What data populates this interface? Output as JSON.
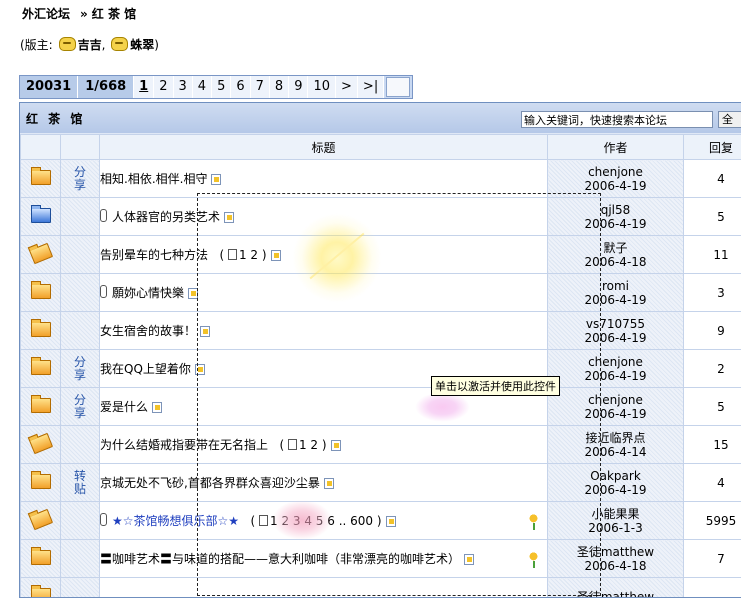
{
  "breadcrumb": {
    "forum": "外汇论坛",
    "separator": "»",
    "board": "红 茶 馆"
  },
  "moderators": {
    "prefix": "(版主:",
    "names": [
      "吉吉",
      "蛛翠"
    ],
    "suffix": ")"
  },
  "pager": {
    "total_threads": "20031",
    "current": "1/668",
    "pages": [
      "1",
      "2",
      "3",
      "4",
      "5",
      "6",
      "7",
      "8",
      "9",
      "10"
    ],
    "next": ">",
    "last": ">|"
  },
  "board_header": {
    "title": "红 茶 馆",
    "search_placeholder": "输入关键词，快速搜索本论坛",
    "search_button": "全"
  },
  "columns": {
    "title": "标题",
    "author": "作者",
    "replies": "回复"
  },
  "new_badge": "NEW",
  "threads": [
    {
      "icon": "folder",
      "tag": "分享",
      "title": "相知.相依.相伴.相守",
      "author": "chenjone",
      "date": "2006-4-19",
      "replies": "4"
    },
    {
      "icon": "folder-blue",
      "tag": "",
      "clip": true,
      "title": "人体器官的另类艺术",
      "author": "qjl58",
      "date": "2006-4-19",
      "replies": "5"
    },
    {
      "icon": "folder-open",
      "tag": "",
      "title": "告别晕车的七种方法",
      "pages": "1 2",
      "author": "默子",
      "date": "2006-4-18",
      "replies": "11"
    },
    {
      "icon": "folder",
      "tag": "",
      "clip": true,
      "title": "願妳心情快樂",
      "author": "romi",
      "date": "2006-4-19",
      "replies": "3"
    },
    {
      "icon": "folder",
      "tag": "",
      "title": "女生宿舍的故事！",
      "author": "vs710755",
      "date": "2006-4-19",
      "replies": "9"
    },
    {
      "icon": "folder",
      "tag": "分享",
      "title": "我在QQ上望着你",
      "author": "chenjone",
      "date": "2006-4-19",
      "replies": "2"
    },
    {
      "icon": "folder",
      "tag": "分享",
      "title": "爱是什么",
      "author": "chenjone",
      "date": "2006-4-19",
      "replies": "5"
    },
    {
      "icon": "folder-open",
      "tag": "",
      "title": "为什么结婚戒指要带在无名指上",
      "pages": "1 2",
      "author": "接近临界点",
      "date": "2006-4-14",
      "replies": "15"
    },
    {
      "icon": "folder",
      "tag": "转贴",
      "title": "京城无处不飞砂,首都各界群众喜迎沙尘暴",
      "author": "Oakpark",
      "date": "2006-4-19",
      "replies": "4"
    },
    {
      "icon": "folder-open",
      "tag": "",
      "clip": true,
      "title": "★☆茶馆畅想俱乐部☆★",
      "pages": "1 2 3 4 5 6 .. 600",
      "flower": true,
      "author": "小能果果",
      "date": "2006-1-3",
      "replies": "5995"
    },
    {
      "icon": "folder",
      "tag": "",
      "title": "〓咖啡艺术〓与味道的搭配——意大利咖啡（非常漂亮的咖啡艺术）",
      "flower": true,
      "author": "圣徒matthew",
      "date": "2006-4-18",
      "replies": "7"
    },
    {
      "icon": "folder",
      "tag": "",
      "title": "",
      "author": "圣徒matthew",
      "date": "",
      "replies": ""
    }
  ],
  "activex_tooltip": "单击以激活并使用此控件"
}
